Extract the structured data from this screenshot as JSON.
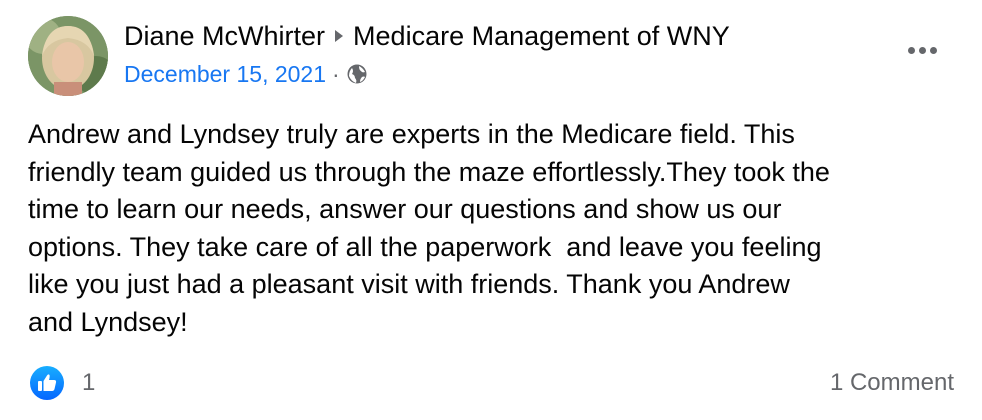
{
  "post": {
    "author": "Diane McWhirter",
    "page_name": "Medicare Management of WNY",
    "date": "December 15, 2021",
    "separator": "·",
    "audience_icon": "globe-icon",
    "header_arrow_icon": "triangle-right-icon",
    "more_icon": "more-options-icon",
    "body": "Andrew and Lyndsey truly are experts in the Medicare field. This\nfriendly team guided us through the maze effortlessly.They took the\ntime to learn our needs, answer our questions and show us our\noptions. They take care of all the paperwork  and leave you feeling\nlike you just had a pleasant visit with friends. Thank you Andrew\nand Lyndsey!"
  },
  "footer": {
    "reaction_icon": "like-icon",
    "like_count": "1",
    "comments_label": "1 Comment"
  },
  "colors": {
    "link_blue": "#1877f2",
    "secondary_text": "#65676b",
    "primary_text": "#050505"
  }
}
